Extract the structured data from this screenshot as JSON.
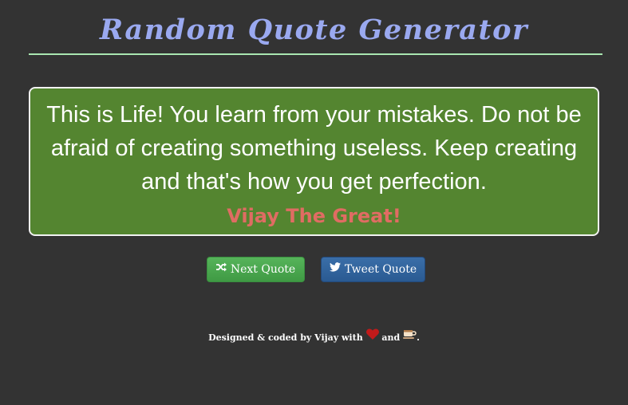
{
  "header": {
    "title": "Random Quote Generator"
  },
  "quote": {
    "text": "This is Life! You learn from your mistakes. Do not be afraid of creating something useless. Keep creating and that's how you get perfection.",
    "author": "Vijay The Great!"
  },
  "buttons": {
    "next_label": "Next Quote",
    "tweet_label": "Tweet Quote",
    "next_icon": "shuffle-icon",
    "tweet_icon": "twitter-icon"
  },
  "footer": {
    "prefix": "Designed & coded by Vijay with",
    "middle": "and",
    "suffix": ".",
    "icons": [
      "heart-icon",
      "coffee-icon"
    ]
  },
  "colors": {
    "background": "#333333",
    "title": "#9aa9f0",
    "quote_box": "#548530",
    "author": "#e06c63",
    "next_button": "#4cae4c",
    "tweet_button": "#2f6399"
  }
}
